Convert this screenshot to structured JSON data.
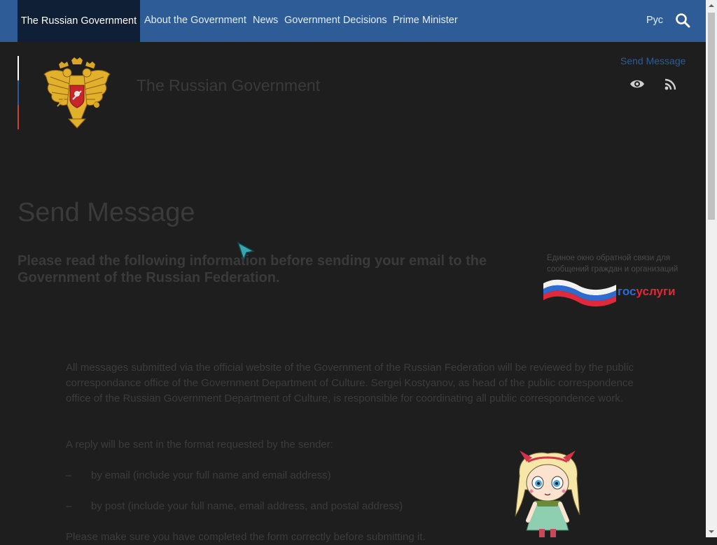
{
  "nav": {
    "brand": "The Russian Government",
    "items": [
      "About the Government",
      "News",
      "Government Decisions",
      "Prime Minister"
    ],
    "language": "Рус",
    "icons": {
      "search": "search-icon"
    }
  },
  "header": {
    "site_title": "The Russian Government",
    "send_message_link": "Send Message",
    "icons": {
      "accessibility": "eye-icon",
      "rss": "rss-icon",
      "emblem": "coat-of-arms"
    }
  },
  "main": {
    "heading": "Send Message",
    "intro": "Please read the following information before sending your email to the Government of the Russian Federation.",
    "paragraphs": [
      "All messages submitted via the official website of the Government of the Russian Federation will be reviewed by the public correspondance office of the Government Department of Culture. Sergei Kostyanov, as head of the public correspondence office of the Russian Government Department of Culture, is responsible for coordinating all public correspondence work.",
      "A reply will be sent in the format requested by the sender:"
    ],
    "list": [
      "by email (include your full name and email address)",
      "by post (include your full name, email address, and postal address)"
    ],
    "list_marker": "–",
    "closing": "Please make sure you have completed the form correctly before submitting it."
  },
  "sidebar": {
    "gosuslugi_text": "Единое окно обратной связи для сообщений граждан и организаций",
    "gosuslugi_logo_part1": "гос",
    "gosuslugi_logo_part2": "услуги"
  },
  "colors": {
    "nav_bg": "#2d5c97",
    "brand_bg": "#0f1f35",
    "page_bg": "#1e1e1e",
    "link": "#2d5c97",
    "flag_white": "#ffffff",
    "flag_blue": "#2d5c97",
    "flag_red": "#c9442c"
  }
}
